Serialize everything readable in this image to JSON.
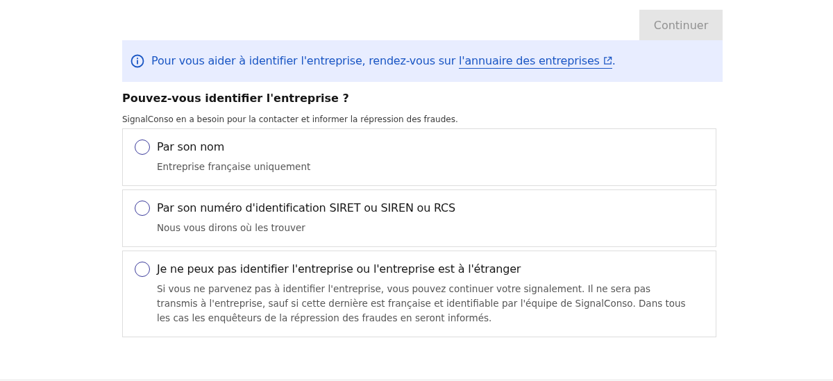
{
  "continue_button": {
    "label": "Continuer",
    "disabled": true
  },
  "info": {
    "text": "Pour vous aider à identifier l'entreprise, rendez-vous sur ",
    "link": "l'annuaire des entreprises",
    "end": "."
  },
  "question": {
    "title": "Pouvez-vous identifier l'entreprise ?",
    "hint": "SignalConso en a besoin pour la contacter et informer la répression des fraudes."
  },
  "options": [
    {
      "label": "Par son nom",
      "description": "Entreprise française uniquement",
      "selected": false
    },
    {
      "label": "Par son numéro d'identification SIRET ou SIREN ou RCS",
      "description": "Nous vous dirons où les trouver",
      "selected": false
    },
    {
      "label": "Je ne peux pas identifier l'entreprise ou l'entreprise est à l'étranger",
      "description": "Si vous ne parvenez pas à identifier l'entreprise, vous pouvez continuer votre signalement. Il ne sera pas transmis à l'entreprise, sauf si cette dernière est française et identifiable par l'équipe de SignalConso. Dans tous les cas les enquêteurs de la répression des fraudes en seront informés.",
      "selected": false
    }
  ]
}
